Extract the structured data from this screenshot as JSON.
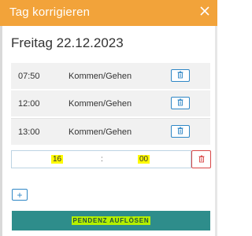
{
  "dialog": {
    "title": "Tag korrigieren",
    "close_icon": "close-icon",
    "date": "Freitag 22.12.2023"
  },
  "entries": [
    {
      "time": "07:50",
      "kind": "Kommen/Gehen",
      "icon": "trash-icon"
    },
    {
      "time": "12:00",
      "kind": "Kommen/Gehen",
      "icon": "trash-icon"
    },
    {
      "time": "13:00",
      "kind": "Kommen/Gehen",
      "icon": "trash-icon"
    }
  ],
  "new_entry": {
    "hours": "16",
    "separator": ":",
    "minutes": "00",
    "delete_icon": "trash-icon"
  },
  "add_button": "+",
  "resolve_button": "PENDENZ AUFLÖSEN",
  "colors": {
    "header": "#f2a33a",
    "accent_blue": "#2f87c6",
    "danger": "#d84747",
    "primary_button": "#2e8d8b",
    "highlight": "#fffb00"
  }
}
